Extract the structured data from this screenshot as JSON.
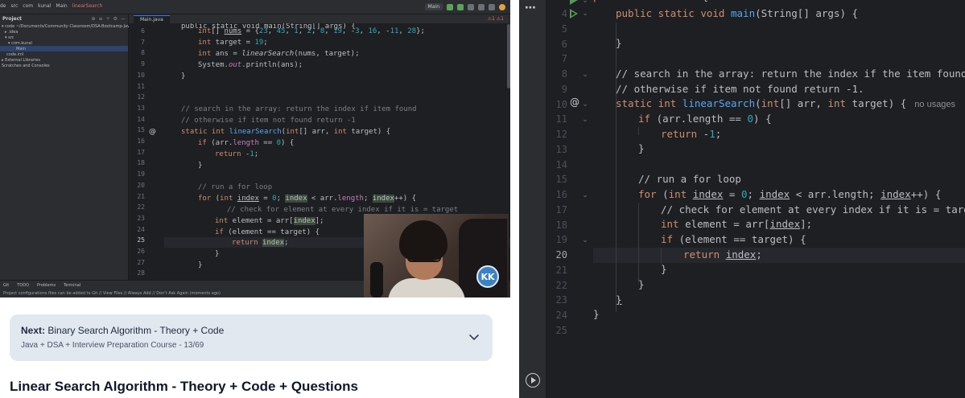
{
  "video": {
    "crumbs": [
      "de",
      "src",
      "com",
      "kunal",
      "Main",
      "linearSearch"
    ],
    "run_config": "Main",
    "project_header": "Project",
    "project_tools": [
      "⊕",
      "≡",
      "÷",
      "⚙",
      "—"
    ],
    "tree": [
      {
        "label": "▾ code  ~/Documents/Community Classroom/DSA-Bootcamp-Java",
        "selected": false,
        "indent": 2
      },
      {
        "label": "▸ .idea",
        "selected": false,
        "indent": 6
      },
      {
        "label": "▾ src",
        "selected": false,
        "indent": 6
      },
      {
        "label": "▾ com.kunal",
        "selected": false,
        "indent": 10
      },
      {
        "label": "Main",
        "selected": true,
        "indent": 20
      },
      {
        "label": "code.iml",
        "selected": false,
        "indent": 8
      },
      {
        "label": "▸ External Libraries",
        "selected": false,
        "indent": 2
      },
      {
        "label": "Scratches and Consoles",
        "selected": false,
        "indent": 2
      }
    ],
    "tab_label": "Main.java",
    "warn_text": "⚠1 ⚠1",
    "line_numbers": [
      "6",
      "7",
      "8",
      "9",
      "10",
      "11",
      "12",
      "13",
      "14",
      "15",
      "16",
      "17",
      "18",
      "19",
      "20",
      "21",
      "22",
      "23",
      "24",
      "25",
      "26",
      "27",
      "28"
    ],
    "current_line": "25",
    "at_line": "15",
    "bottom_tabs": [
      "Git",
      "TODO",
      "Problems",
      "Terminal"
    ],
    "status_text": "Project configurations files can be added to Git // View Files // Always Add // Don't Ask Again (moments ago)",
    "logo_text": "KK"
  },
  "next_card": {
    "prefix": "Next:",
    "title": "Binary Search Algorithm - Theory + Code",
    "subtitle": "Java + DSA + Interview Preparation Course - 13/69"
  },
  "lesson_title": "Linear Search Algorithm - Theory + Code + Questions",
  "ide": {
    "more_label": "⋯",
    "line_numbers": [
      "4",
      "5",
      "6",
      "7",
      "8",
      "9",
      "10",
      "11",
      "12",
      "13",
      "14",
      "15",
      "16",
      "17",
      "18",
      "19",
      "20",
      "21",
      "22",
      "23",
      "24",
      "25"
    ],
    "current_line": "20",
    "usage_hint": "no usages",
    "top_partial": "public class Main {"
  }
}
